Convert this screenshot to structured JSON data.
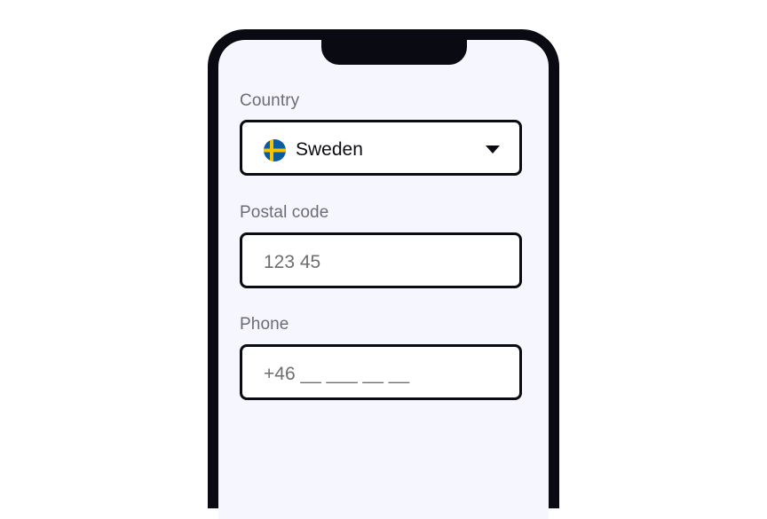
{
  "form": {
    "country": {
      "label": "Country",
      "selected": "Sweden",
      "flag_icon": "sweden-flag-icon",
      "flag_colors": {
        "blue": "#0b5c9e",
        "yellow": "#f5c400"
      }
    },
    "postal_code": {
      "label": "Postal code",
      "placeholder": "123 45"
    },
    "phone": {
      "label": "Phone",
      "placeholder": "+46 __ ___ __ __"
    }
  },
  "colors": {
    "phone_frame": "#0a0b12",
    "screen_background": "#f5f6fe",
    "label_text": "#6b6c76",
    "field_border": "#0b0c12"
  }
}
